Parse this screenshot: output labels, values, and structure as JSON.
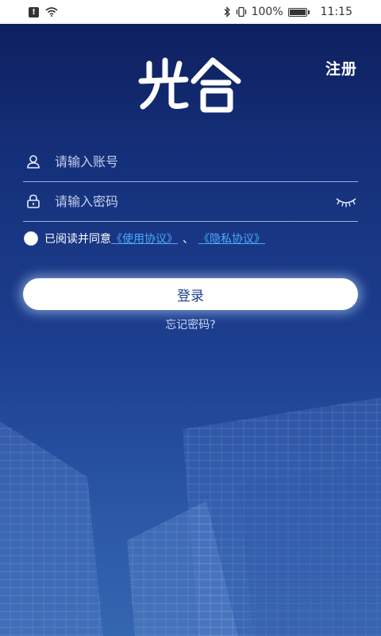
{
  "status_bar": {
    "battery_text": "100%",
    "time": "11:15"
  },
  "header": {
    "logo_text": "光合",
    "register_label": "注册"
  },
  "form": {
    "account_placeholder": "请输入账号",
    "password_placeholder": "请输入密码",
    "agree_text": "已阅读并同意",
    "terms_link": "《使用协议》",
    "separator": "、",
    "privacy_link": "《隐私协议》",
    "login_label": "登录",
    "forgot_label": "忘记密码?"
  },
  "colors": {
    "background_top": "#0d1d5a",
    "background_bottom": "#3566b0",
    "link": "#4da8ff",
    "button_text": "#1f3f8c"
  }
}
